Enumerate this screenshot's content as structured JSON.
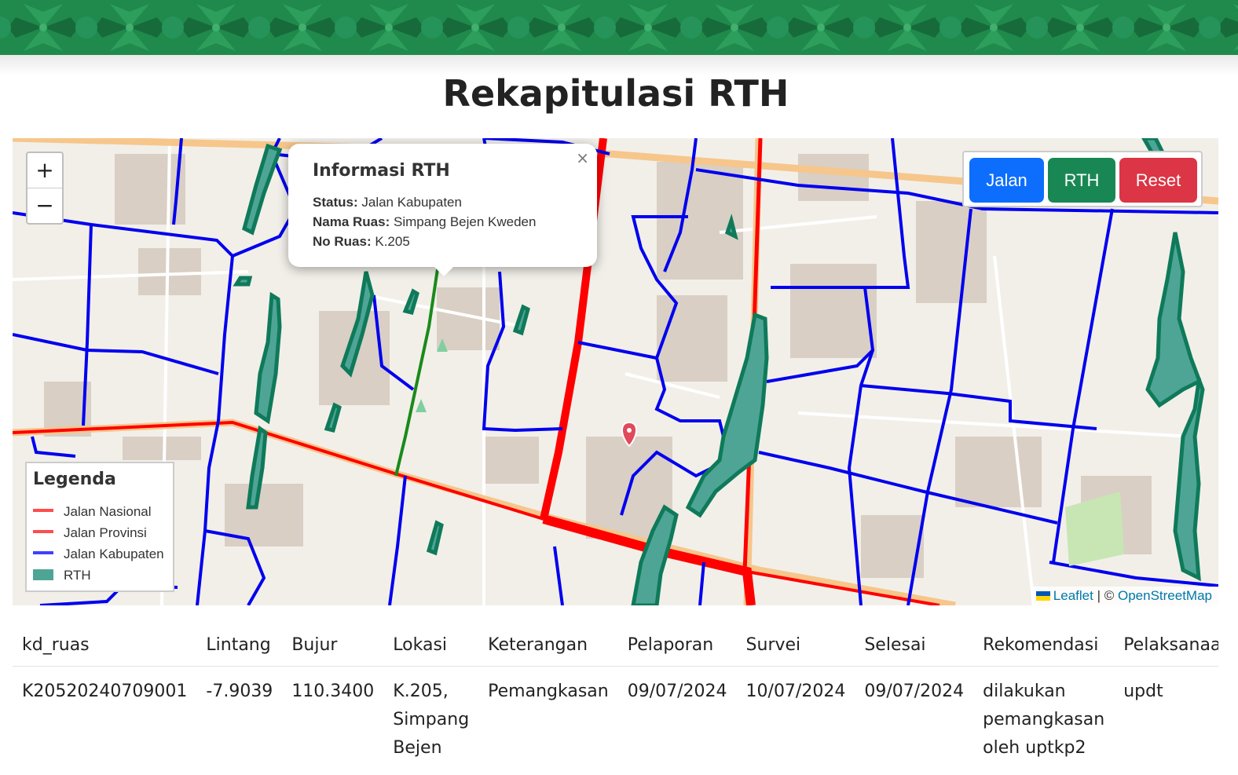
{
  "page": {
    "title": "Rekapitulasi RTH"
  },
  "map": {
    "zoom_in": "+",
    "zoom_out": "−",
    "popup": {
      "title": "Informasi RTH",
      "close": "×",
      "status_label": "Status:",
      "status_value": "Jalan Kabupaten",
      "nama_label": "Nama Ruas:",
      "nama_value": "Simpang Bejen Kweden",
      "no_label": "No Ruas:",
      "no_value": "K.205"
    },
    "layer_buttons": {
      "jalan": "Jalan",
      "rth": "RTH",
      "reset": "Reset"
    },
    "legend": {
      "title": "Legenda",
      "items": [
        {
          "label": "Jalan Nasional",
          "color": "#ff4d4d"
        },
        {
          "label": "Jalan Provinsi",
          "color": "#ff4d4d"
        },
        {
          "label": "Jalan Kabupaten",
          "color": "#4040ff"
        },
        {
          "label": "RTH",
          "color": "#4ea596"
        }
      ]
    },
    "attribution": {
      "leaflet": "Leaflet",
      "sep": "| ©",
      "osm": "OpenStreetMap"
    },
    "colors": {
      "nasional": "#ff0000",
      "kabupaten": "#0000ee",
      "rth": "#0f7a5a",
      "selected": "#1a8a1a"
    }
  },
  "table": {
    "headers": [
      "kd_ruas",
      "Lintang",
      "Bujur",
      "Lokasi",
      "Keterangan",
      "Pelaporan",
      "Survei",
      "Selesai",
      "Rekomendasi",
      "Pelaksanaan"
    ],
    "rows": [
      {
        "kd_ruas": "K20520240709001",
        "lintang": "-7.9039",
        "bujur": "110.3400",
        "lokasi": "K.205, Simpang Bejen",
        "keterangan": "Pemangkasan",
        "pelaporan": "09/07/2024",
        "survei": "10/07/2024",
        "selesai": "09/07/2024",
        "rekomendasi": "dilakukan pemangkasan oleh uptkp2",
        "pelaksanaan": "updt"
      }
    ]
  }
}
